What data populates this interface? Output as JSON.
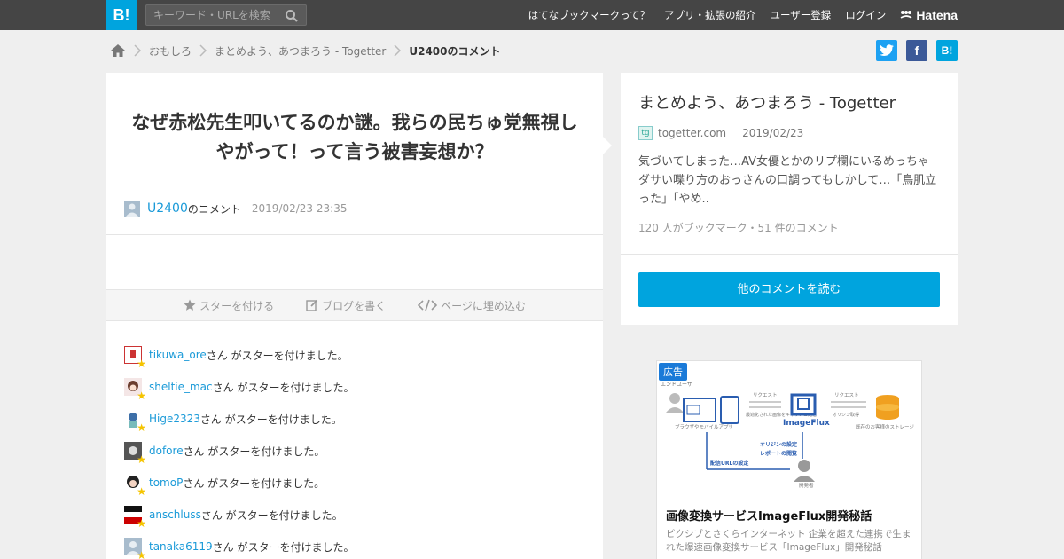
{
  "header": {
    "logo": "B!",
    "search_placeholder": "キーワード・URLを検索",
    "nav": [
      "はてなブックマークって？",
      "アプリ・拡張の紹介",
      "ユーザー登録",
      "ログイン"
    ],
    "brand": "Hatena"
  },
  "breadcrumb": {
    "items": [
      "おもしろ",
      "まとめよう、あつまろう - Togetter",
      "U2400のコメント"
    ]
  },
  "share": {
    "facebook": "f",
    "hatena": "B!"
  },
  "comment": {
    "text": "なぜ赤松先生叩いてるのか謎。我らの民ちゅ党無視しやがって！って言う被害妄想か？",
    "user": "U2400",
    "suffix": "のコメント",
    "timestamp": "2019/02/23 23:35"
  },
  "actions": {
    "star": "スターを付ける",
    "blog": "ブログを書く",
    "embed": "ページに埋め込む"
  },
  "stars": {
    "suffix": "さん がスターを付けました。",
    "users": [
      "tikuwa_ore",
      "sheltie_mac",
      "Hige2323",
      "dofore",
      "tomoP",
      "anschluss",
      "tanaka6119"
    ]
  },
  "entry": {
    "title": "まとめよう、あつまろう - Togetter",
    "favicon": "tg",
    "domain": "togetter.com",
    "date": "2019/02/23",
    "summary": "気づいてしまった…AV女優とかのリプ欄にいるめっちゃダサい喋り方のおっさんの口調ってもしかして…「鳥肌立った」「やめ..",
    "stats": "120 人がブックマーク・51 件のコメント",
    "read_button": "他のコメントを読む"
  },
  "ad": {
    "badge": "広告",
    "diagram": {
      "enduser": "エンドユーザ",
      "browser": "ブラウザやモバイルアプリ",
      "request1": "リクエスト",
      "optimized": "最適化された画像をキャッシュ配信",
      "product": "ImageFlux",
      "request2": "リクエスト",
      "origin_fetch": "オリジン取得",
      "storage": "既存のお客様のストレージ",
      "origin_setting": "オリジンの設定",
      "report": "レポートの閲覧",
      "url_setting": "配信URLの設定",
      "developer": "開発者"
    },
    "title": "画像変換サービスImageFlux開発秘話",
    "description": "ピクシブとさくらインターネット 企業を超えた連携で生まれた爆速画像変換サービス「ImageFlux」開発秘話"
  },
  "colors": {
    "accent": "#00a4de",
    "topbar": "#454545",
    "link": "#1a9ad8",
    "star": "#f5c400"
  }
}
